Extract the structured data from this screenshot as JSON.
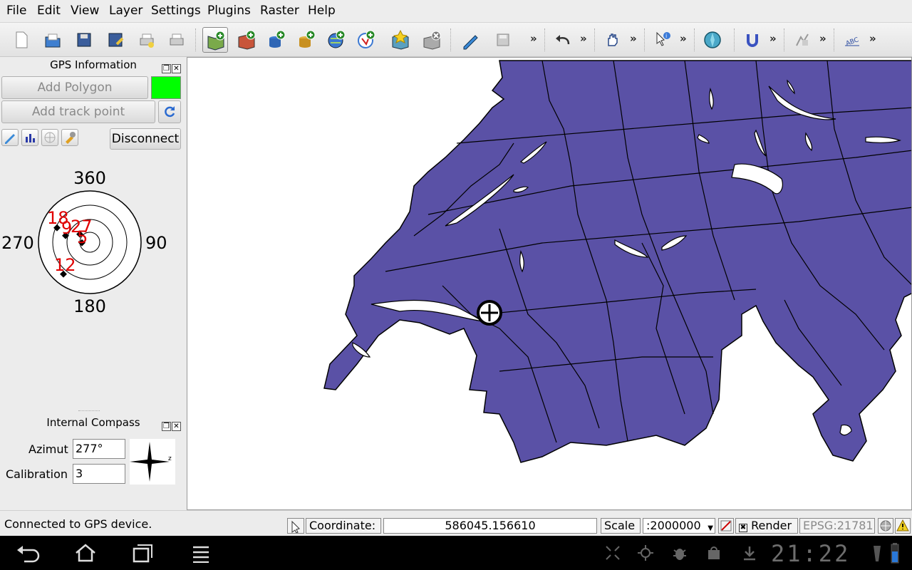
{
  "menu": [
    "File",
    "Edit",
    "View",
    "Layer",
    "Settings",
    "Plugins",
    "Raster",
    "Help"
  ],
  "gps": {
    "title": "GPS Information",
    "add_polygon": "Add Polygon",
    "add_track_point": "Add track point",
    "disconnect": "Disconnect",
    "polygon_color": "#00ff00",
    "compass_labels": {
      "n": "360",
      "e": "90",
      "s": "180",
      "w": "270"
    },
    "satellites": [
      "18",
      "27",
      "9",
      "5",
      "12"
    ]
  },
  "compass": {
    "title": "Internal Compass",
    "azimut_label": "Azimut",
    "azimut_value": "277°",
    "calibration_label": "Calibration",
    "calibration_value": "3",
    "rose_letter": "z"
  },
  "status": {
    "message": "Connected to GPS device.",
    "coordinate_label": "Coordinate:",
    "coordinate_value": "586045.156610",
    "scale_label": "Scale",
    "scale_value": ":2000000",
    "render_label": "Render",
    "epsg": "EPSG:21781"
  },
  "clock": "21:22",
  "colors": {
    "map_fill": "#5a51a6",
    "map_stroke": "#000000",
    "lake": "#ffffff"
  }
}
